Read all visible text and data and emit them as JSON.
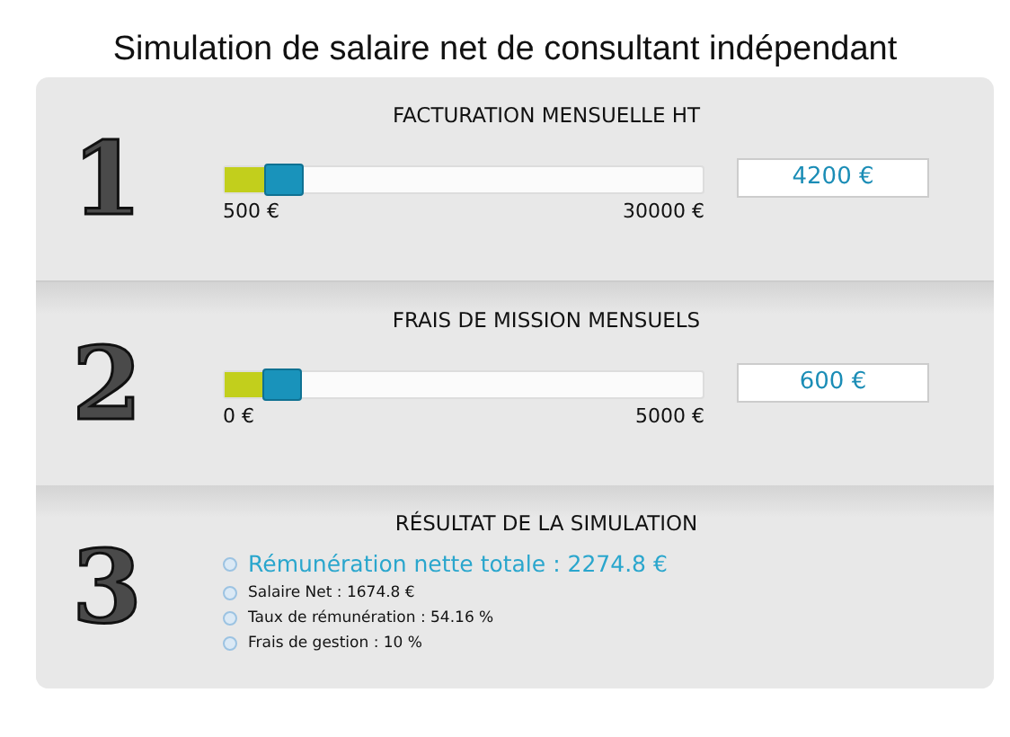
{
  "title": "Simulation de salaire net de consultant indépendant",
  "sections": [
    {
      "kind": "slider",
      "number": "1",
      "heading": "FACTURATION MENSUELLE HT",
      "level": 0.125,
      "min_label": "500 €",
      "max_label": "30000 €",
      "value": "4200 €"
    },
    {
      "kind": "slider",
      "number": "2",
      "heading": "FRAIS DE MISSION MENSUELS",
      "level": 0.12,
      "min_label": "0 €",
      "max_label": "5000 €",
      "value": "600 €"
    },
    {
      "kind": "result",
      "number": "3",
      "heading": "RÉSULTAT DE LA SIMULATION",
      "items": [
        {
          "kind": "main",
          "text": "Rémunération nette totale : 2274.8 €"
        },
        {
          "kind": "detail",
          "text": "Salaire Net : 1674.8 €"
        },
        {
          "kind": "detail",
          "text": "Taux de rémunération : 54.16 %"
        },
        {
          "kind": "detail",
          "text": "Frais de gestion : 10 %"
        }
      ]
    }
  ]
}
